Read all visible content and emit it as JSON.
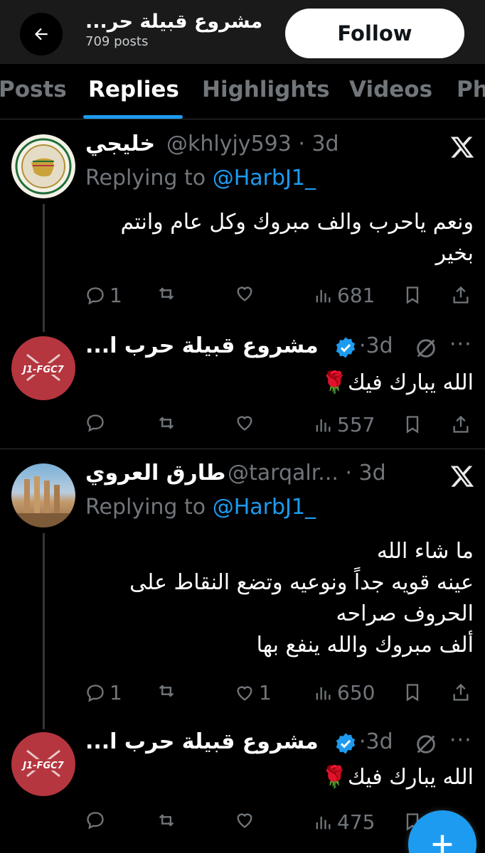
{
  "header": {
    "title": "مشروع قبيلة حر...",
    "post_count": "709 posts",
    "follow_label": "Follow"
  },
  "tabs": [
    "Posts",
    "Replies",
    "Highlights",
    "Videos",
    "Ph"
  ],
  "active_tab": "Replies",
  "posts": [
    {
      "display_name": "خليجي",
      "handle": "@khlyjy593",
      "time": "3d",
      "replying_prefix": "Replying to",
      "replying_to": "@HarbJ1_",
      "text": "ونعم ياحرب والف مبروك وكل عام وانتم بخير",
      "replies": "1",
      "reposts": "",
      "likes": "",
      "views": "681"
    },
    {
      "display_name": "مشروع قبيلة حرب ا...",
      "time": "3d",
      "text": "الله يبارك فيك🌹",
      "replies": "",
      "reposts": "",
      "likes": "",
      "views": "557",
      "avatar_text": "J1-FGC7"
    },
    {
      "display_name": "طارق العروي",
      "handle": "@tarqalr...",
      "time": "3d",
      "replying_prefix": "Replying to",
      "replying_to": "@HarbJ1_",
      "text_lines": [
        "ما شاء الله",
        "عينه قويه جداً ونوعيه وتضع النقاط على",
        "الحروف صراحه",
        "ألف مبروك والله ينفع بها"
      ],
      "replies": "1",
      "reposts": "",
      "likes": "1",
      "views": "650"
    },
    {
      "display_name": "مشروع قبيلة حرب ا...",
      "time": "3d",
      "text": "الله يبارك فيك🌹",
      "replies": "",
      "reposts": "",
      "likes": "",
      "views": "475",
      "avatar_text": "J1-FGC7"
    }
  ],
  "colors": {
    "accent": "#1d9bf0",
    "muted": "#71767b",
    "background": "#000000"
  }
}
